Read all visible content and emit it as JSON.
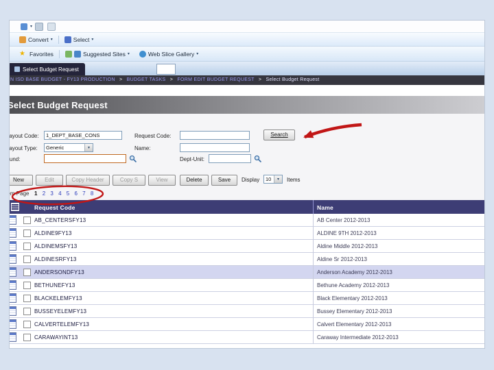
{
  "browser": {
    "command_bar": {
      "convert_label": "Convert",
      "select_label": "Select"
    },
    "favorites_bar": {
      "favorites_label": "Favorites",
      "suggested_sites_label": "Suggested Sites",
      "web_slice_label": "Web Slice Gallery"
    },
    "tab_title": "Select Budget Request"
  },
  "breadcrumb": {
    "separator": ">",
    "items": [
      "N ISD BASE BUDGET - FY13 PRODUCTION",
      "BUDGET TASKS",
      "FORM EDIT BUDGET REQUEST",
      "Select Budget Request"
    ]
  },
  "page": {
    "title": "Select Budget Request"
  },
  "form": {
    "layout_code": {
      "label": "Layout Code:",
      "value": "1_DEPT_BASE_CONS"
    },
    "request_code": {
      "label": "Request Code:",
      "value": ""
    },
    "layout_type": {
      "label": "Layout Type:",
      "value": "Generic"
    },
    "name": {
      "label": "Name:",
      "value": ""
    },
    "fund": {
      "label": "Fund:",
      "value": ""
    },
    "dept_unit": {
      "label": "Dept-Unit:",
      "value": ""
    },
    "search_label": "Search"
  },
  "actions": {
    "buttons": [
      {
        "label": "New",
        "enabled": true
      },
      {
        "label": "Edit",
        "enabled": false
      },
      {
        "label": "Copy Header",
        "enabled": false
      },
      {
        "label": "Copy S",
        "enabled": false
      },
      {
        "label": "View",
        "enabled": false
      },
      {
        "label": "Delete",
        "enabled": true
      },
      {
        "label": "Save",
        "enabled": true
      }
    ],
    "display_label": "Display",
    "display_value": "10",
    "items_label": "Items"
  },
  "pagination": {
    "label": "Item Page",
    "pages": [
      "1",
      "2",
      "3",
      "4",
      "5",
      "6",
      "7",
      "8"
    ],
    "current": "1"
  },
  "table": {
    "headers": [
      "Request Code",
      "Name"
    ],
    "rows": [
      {
        "code": "AB_CENTERSFY13",
        "name": "AB Center 2012-2013",
        "selected": false
      },
      {
        "code": "ALDINE9FY13",
        "name": "ALDINE 9TH 2012-2013",
        "selected": false
      },
      {
        "code": "ALDINEMSFY13",
        "name": "Aldine Middle 2012-2013",
        "selected": false
      },
      {
        "code": "ALDINESRFY13",
        "name": "Aldine Sr 2012-2013",
        "selected": false
      },
      {
        "code": "ANDERSONDFY13",
        "name": "Anderson Academy 2012-2013",
        "selected": true
      },
      {
        "code": "BETHUNEFY13",
        "name": "Bethune Academy 2012-2013",
        "selected": false
      },
      {
        "code": "BLACKELEMFY13",
        "name": "Black Elementary 2012-2013",
        "selected": false
      },
      {
        "code": "BUSSEYELEMFY13",
        "name": "Bussey Elementary 2012-2013",
        "selected": false
      },
      {
        "code": "CALVERTELEMFY13",
        "name": "Calvert Elementary 2012-2013",
        "selected": false
      },
      {
        "code": "CARAWAYINT13",
        "name": "Caraway Intermediate 2012-2013",
        "selected": false
      }
    ]
  },
  "icons": {
    "caret": "▾",
    "star": "★",
    "search_icon": "magnifier"
  },
  "colors": {
    "annotation_red": "#c11616",
    "table_header": "#3d3d75",
    "selected_row": "#d3d6f0",
    "fund_border_orange": "#c06820",
    "slide_background": "#d8e2f0"
  }
}
